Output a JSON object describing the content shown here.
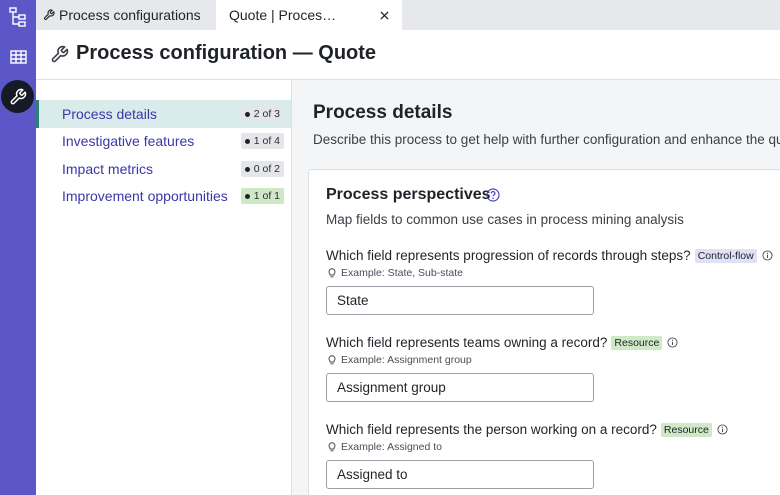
{
  "tabs": [
    {
      "label": "Process configurations",
      "icon": "wrench-icon"
    },
    {
      "label": "Quote | Process configuration",
      "icon": "close-icon"
    }
  ],
  "header": {
    "title": "Process configuration — Quote"
  },
  "sidebar": {
    "items": [
      {
        "label": "Process details",
        "badge": "2 of 3",
        "active": true
      },
      {
        "label": "Investigative features",
        "badge": "1 of 4"
      },
      {
        "label": "Impact metrics",
        "badge": "0 of 2"
      },
      {
        "label": "Improvement opportunities",
        "badge": "1 of 1",
        "complete": true
      }
    ]
  },
  "main": {
    "title": "Process details",
    "description": "Describe this process to get help with further configuration and enhance the quality of insights",
    "card": {
      "title": "Process perspectives",
      "description": "Map fields to common use cases in process mining analysis",
      "questions": [
        {
          "label": "Which field represents progression of records through steps?",
          "tag": "Control-flow",
          "example": "Example: State, Sub-state",
          "value": "State"
        },
        {
          "label": "Which field represents teams owning a record?",
          "tag": "Resource",
          "example": "Example: Assignment group",
          "value": "Assignment group"
        },
        {
          "label": "Which field represents the person working on a record?",
          "tag": "Resource",
          "example": "Example: Assigned to",
          "value": "Assigned to"
        }
      ]
    }
  },
  "colors": {
    "rail": "#5b57c9",
    "nav_active_bg": "#d9ebea",
    "nav_active_border": "#2f7f7a",
    "link": "#3b36a8",
    "tag_controlflow": "#e0e0f8",
    "tag_resource": "#cfe9c7"
  }
}
